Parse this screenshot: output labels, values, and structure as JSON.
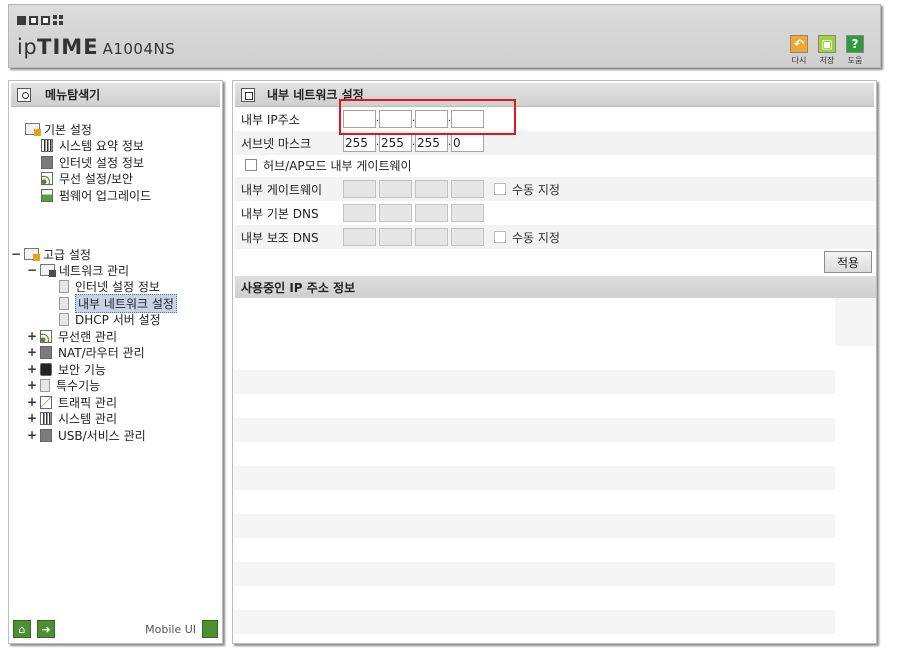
{
  "header": {
    "brand_ip": "ip",
    "brand_time": "TIME",
    "model": "A1004NS",
    "tools": [
      {
        "label": "다시",
        "icon": "undo-icon",
        "color": "#f0a830"
      },
      {
        "label": "저장",
        "icon": "save-icon",
        "color": "#9fcf3a"
      },
      {
        "label": "도움",
        "icon": "help-icon",
        "color": "#2e9a3a"
      }
    ]
  },
  "left": {
    "title": "메뉴탐색기",
    "basic": {
      "label": "기본 설정",
      "items": [
        "시스템 요약 정보",
        "인터넷 설정 정보",
        "무선 설정/보안",
        "펌웨어 업그레이드"
      ]
    },
    "advanced": {
      "label": "고급 설정",
      "network": {
        "label": "네트워크 관리",
        "items": [
          "인터넷 설정 정보",
          "내부 네트워크 설정",
          "DHCP 서버 설정"
        ],
        "selected": "내부 네트워크 설정"
      },
      "groups": [
        "무선랜 관리",
        "NAT/라우터 관리",
        "보안 기능",
        "특수기능",
        "트래픽 관리",
        "시스템 관리",
        "USB/서비스 관리"
      ]
    },
    "footer": {
      "mobile_label": "Mobile UI"
    }
  },
  "main": {
    "title": "내부 네트워크 설정",
    "internal_ip_label": "내부 IP주소",
    "internal_ip": [
      "",
      "",
      "",
      ""
    ],
    "subnet_label": "서브넷 마스크",
    "subnet": [
      "255",
      "255",
      "255",
      "0"
    ],
    "hub_ap_label": "허브/AP모드 내부 게이트웨이",
    "gateway_label": "내부 게이트웨이",
    "gateway": [
      "",
      "",
      "",
      ""
    ],
    "dns1_label": "내부 기본 DNS",
    "dns1": [
      "",
      "",
      "",
      ""
    ],
    "dns2_label": "내부 보조 DNS",
    "dns2": [
      "",
      "",
      "",
      ""
    ],
    "manual_label": "수동 지정",
    "apply_label": "적용",
    "ip_info_title": "사용중인 IP 주소 정보"
  },
  "colors": {
    "highlight": "#e0161c",
    "accent_green": "#4e8f33",
    "selected_bg": "#c9d3e6"
  }
}
